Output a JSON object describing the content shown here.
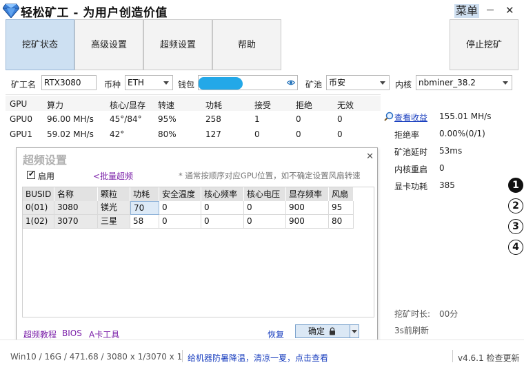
{
  "title": "轻松矿工 - 为用户创造价值",
  "menu_label": "菜单",
  "tabs": [
    {
      "label": "挖矿状态",
      "active": true
    },
    {
      "label": "高级设置",
      "active": false
    },
    {
      "label": "超频设置",
      "active": false
    },
    {
      "label": "帮助",
      "active": false
    }
  ],
  "stop_label": "停止挖矿",
  "config": {
    "miner_name_label": "矿工名",
    "miner_name_value": "RTX3080",
    "coin_label": "币种",
    "coin_value": "ETH",
    "wallet_label": "钱包",
    "pool_label": "矿池",
    "pool_value": "币安",
    "kernel_label": "内核",
    "kernel_value": "nbminer_38.2"
  },
  "gpu_table": {
    "headers": [
      "GPU",
      "算力",
      "核心/显存",
      "转速",
      "功耗",
      "接受",
      "拒绝",
      "无效"
    ],
    "rows": [
      [
        "GPU0",
        "96.00 MH/s",
        "45°/84°",
        "95%",
        "258",
        "1",
        "0",
        "0"
      ],
      [
        "GPU1",
        "59.02 MH/s",
        "42°",
        "80%",
        "127",
        "0",
        "0",
        "0"
      ]
    ]
  },
  "stats": {
    "earnings_link": "查看收益",
    "hashrate": "155.01 MH/s",
    "reject_label": "拒绝率",
    "reject_value": "0.00%(0/1)",
    "latency_label": "矿池延时",
    "latency_value": "53ms",
    "restart_label": "内核重启",
    "restart_value": "0",
    "power_label": "显卡功耗",
    "power_value": "385"
  },
  "circles": [
    "1",
    "2",
    "3",
    "4"
  ],
  "overclock_dialog": {
    "title": "超频设置",
    "enable_label": "启用",
    "enabled": true,
    "batch_link": "<批量超频",
    "note": "* 通常按顺序对应GPU位置，如不确定设置风扇转速",
    "columns": [
      "BUSID",
      "名称",
      "颗粒",
      "功耗",
      "安全温度",
      "核心频率",
      "核心电压",
      "显存频率",
      "风扇"
    ],
    "rows": [
      [
        "0(01)",
        "3080",
        "镁光",
        "70",
        "0",
        "0",
        "0",
        "900",
        "95"
      ],
      [
        "1(02)",
        "3070",
        "三星",
        "58",
        "0",
        "0",
        "0",
        "900",
        "80"
      ]
    ],
    "links": [
      "超频教程",
      "BIOS",
      "A卡工具"
    ],
    "restore_label": "恢复",
    "ok_label": "确定"
  },
  "bottom": {
    "mining_time_label": "挖矿时长:",
    "mining_time_value": "00分",
    "refresh_note": "3s前刷新"
  },
  "statusbar": {
    "system": "Win10 / 16G / 471.68 / 3080 x 1/3070 x 1",
    "tip": "给机器防暑降温，清凉一夏，点击查看",
    "version": "v4.6.1 检查更新"
  }
}
